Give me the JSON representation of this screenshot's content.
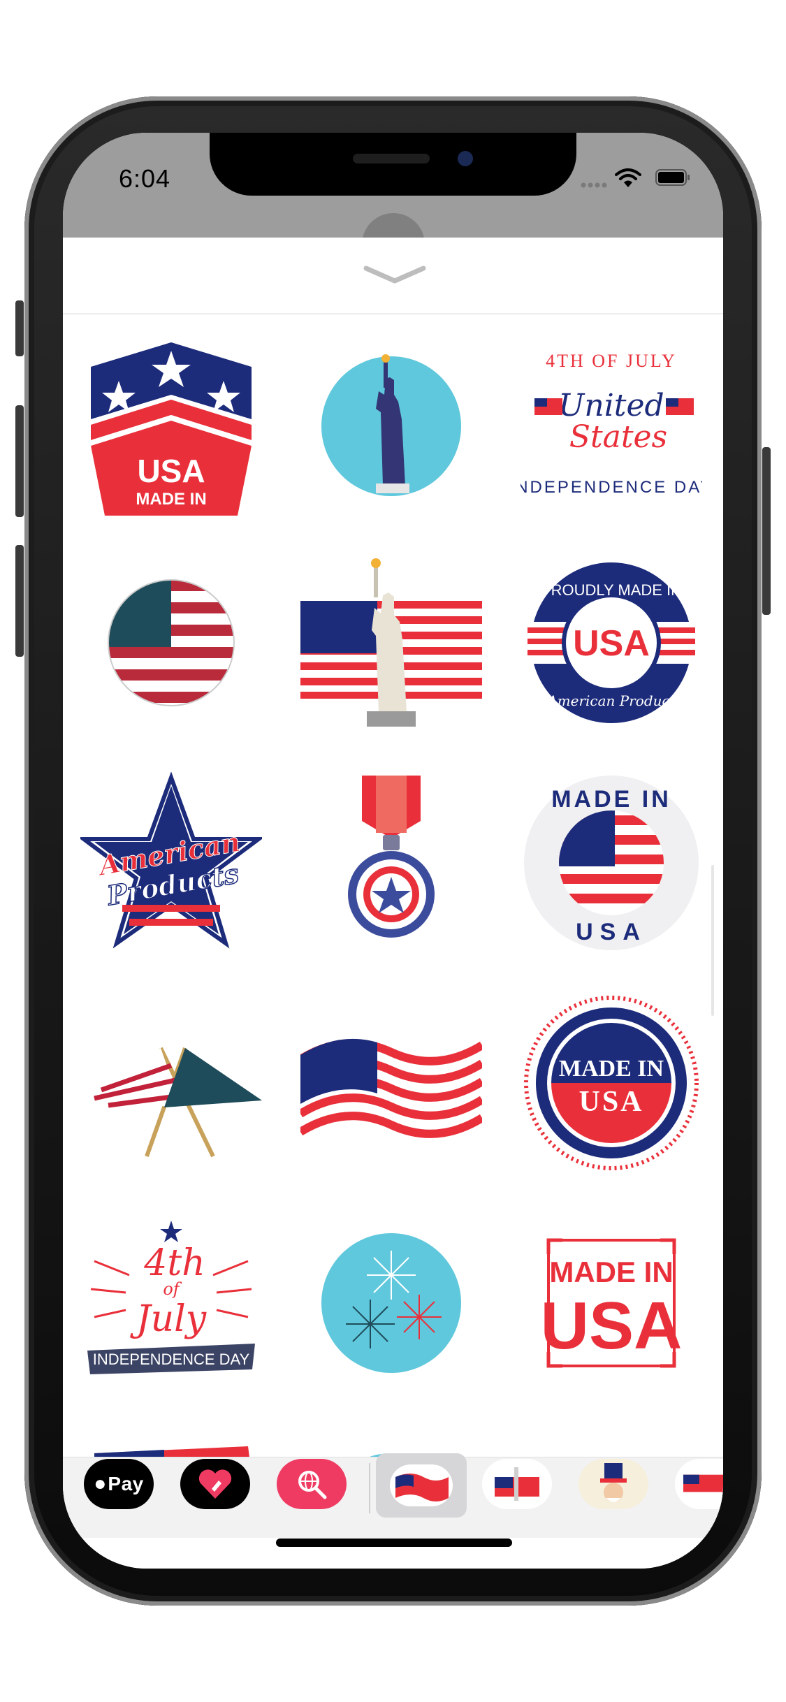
{
  "status_bar": {
    "time": "6:04"
  },
  "stickers": [
    {
      "name": "made-in-usa-shield-sticker",
      "text": [
        "USA",
        "MADE IN"
      ]
    },
    {
      "name": "statue-of-liberty-circle-sticker",
      "text": []
    },
    {
      "name": "4th-of-july-united-states-badge-sticker",
      "text": [
        "4TH OF JULY",
        "United",
        "States",
        "INDEPENDENCE DAY"
      ]
    },
    {
      "name": "us-flag-ball-sticker",
      "text": []
    },
    {
      "name": "flag-with-statue-of-liberty-sticker",
      "text": []
    },
    {
      "name": "proudly-made-in-usa-seal-sticker",
      "text": [
        "PROUDLY MADE IN",
        "USA",
        "American Product"
      ]
    },
    {
      "name": "american-products-star-sticker",
      "text": [
        "American",
        "Products"
      ]
    },
    {
      "name": "star-medal-sticker",
      "text": []
    },
    {
      "name": "made-in-usa-flag-button-sticker",
      "text": [
        "MADE IN",
        "USA"
      ]
    },
    {
      "name": "crossed-pennants-sticker",
      "text": []
    },
    {
      "name": "waving-us-flag-sticker",
      "text": []
    },
    {
      "name": "made-in-usa-round-seal-sticker",
      "text": [
        "MADE IN",
        "USA"
      ]
    },
    {
      "name": "4th-of-july-independence-day-sticker",
      "text": [
        "4th",
        "of",
        "July",
        "INDEPENDENCE DAY"
      ]
    },
    {
      "name": "fireworks-circle-sticker",
      "text": []
    },
    {
      "name": "made-in-usa-stamp-sticker",
      "text": [
        "MADE IN",
        "USA"
      ]
    }
  ],
  "app_bar": {
    "apple_pay_label": "Pay",
    "apps": [
      "apple-pay",
      "digital-touch",
      "web-search",
      "us-flag-sticker-pack",
      "flag-liberty-sticker-pack",
      "uncle-sam-sticker-pack",
      "made-in-usa-sticker-pack"
    ]
  },
  "colors": {
    "navy": "#1c2b7a",
    "red": "#e9303a",
    "light_blue": "#5fc8dc",
    "status_gray": "#9d9d9d",
    "search_pink": "#ef3b62"
  }
}
